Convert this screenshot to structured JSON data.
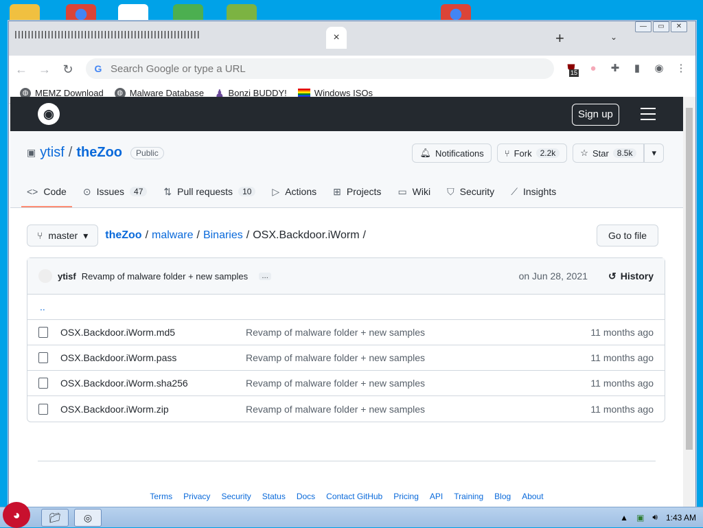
{
  "tabs": {
    "garbled": "ꟾꟾꟾꟾꟾꟾꟾꟾꟾꟾꟾꟾꟾꟾꟾꟾꟾꟾꟾꟾꟾꟾꟾꟾꟾꟾꟾꟾꟾꟾꟾꟾꟾꟾꟾꟾꟾꟾꟾꟾꟾꟾꟾꟾꟾꟾꟾꟾꟾꟾꟾꟾꟾꟾꟾꟾ",
    "close": "×",
    "new_tab": "+",
    "tab_search": "⌄"
  },
  "window_buttons": {
    "minimize": "—",
    "maximize": "▭",
    "close": "✕"
  },
  "toolbar": {
    "placeholder": "Search Google or type a URL",
    "extension_badge": "15"
  },
  "bookmarks": [
    {
      "label": "MEMZ Download"
    },
    {
      "label": "Malware Database"
    },
    {
      "label": "Bonzi BUDDY!"
    },
    {
      "label": "Windows ISOs"
    }
  ],
  "github": {
    "signup": "Sign up",
    "owner": "ytisf",
    "repo": "theZoo",
    "visibility": "Public",
    "notifications": "Notifications",
    "fork": "Fork",
    "fork_count": "2.2k",
    "star": "Star",
    "star_count": "8.5k",
    "nav": [
      {
        "label": "Code",
        "count": ""
      },
      {
        "label": "Issues",
        "count": "47"
      },
      {
        "label": "Pull requests",
        "count": "10"
      },
      {
        "label": "Actions",
        "count": ""
      },
      {
        "label": "Projects",
        "count": ""
      },
      {
        "label": "Wiki",
        "count": ""
      },
      {
        "label": "Security",
        "count": ""
      },
      {
        "label": "Insights",
        "count": ""
      }
    ],
    "branch": "master",
    "breadcrumb": [
      "theZoo",
      "malware",
      "Binaries"
    ],
    "current_dir": "OSX.Backdoor.iWorm",
    "go_to_file": "Go to file",
    "commit": {
      "author": "ytisf",
      "message": "Revamp of malware folder + new samples",
      "ellipsis": "…",
      "date": "on Jun 28, 2021",
      "history": "History"
    },
    "updir": "..",
    "files": [
      {
        "name": "OSX.Backdoor.iWorm.md5",
        "message": "Revamp of malware folder + new samples",
        "age": "11 months ago"
      },
      {
        "name": "OSX.Backdoor.iWorm.pass",
        "message": "Revamp of malware folder + new samples",
        "age": "11 months ago"
      },
      {
        "name": "OSX.Backdoor.iWorm.sha256",
        "message": "Revamp of malware folder + new samples",
        "age": "11 months ago"
      },
      {
        "name": "OSX.Backdoor.iWorm.zip",
        "message": "Revamp of malware folder + new samples",
        "age": "11 months ago"
      }
    ],
    "footer": [
      "Terms",
      "Privacy",
      "Security",
      "Status",
      "Docs",
      "Contact GitHub",
      "Pricing",
      "API",
      "Training",
      "Blog",
      "About"
    ]
  },
  "taskbar": {
    "time": "1:43 AM"
  },
  "colors": {
    "desktop": "#00a2e8",
    "gh_header": "#24292f",
    "link": "#0969da",
    "active_tab_underline": "#fd8c73"
  }
}
